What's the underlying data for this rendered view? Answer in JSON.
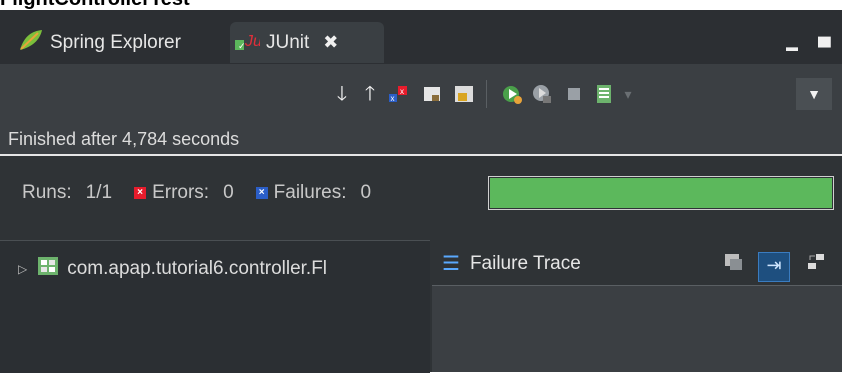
{
  "caption": "FlightControllerTest",
  "tabs": [
    {
      "label": "Spring Explorer",
      "icon": "spring-leaf-icon"
    },
    {
      "label": "JUnit",
      "icon": "junit-icon",
      "close": "✖"
    }
  ],
  "window_buttons": {
    "minimize": "▬",
    "maximize": "▀"
  },
  "toolbar": {
    "icons": [
      "next-failure-icon",
      "previous-failure-icon",
      "show-failures-only-icon",
      "scroll-lock-icon",
      "history-lock-icon",
      "rerun-test-icon",
      "rerun-failed-first-icon",
      "stop-icon",
      "test-run-history-icon",
      "view-menu-icon"
    ]
  },
  "status": {
    "text": "Finished after 4,784 seconds"
  },
  "counters": {
    "runs_label": "Runs:",
    "runs_value": "1/1",
    "errors_label": "Errors:",
    "errors_value": "0",
    "failures_label": "Failures:",
    "failures_value": "0",
    "progress": 1.0,
    "progress_color": "#5cb85c"
  },
  "tree": {
    "item": "com.apap.tutorial6.controller.Fl"
  },
  "trace": {
    "title": "Failure Trace"
  }
}
